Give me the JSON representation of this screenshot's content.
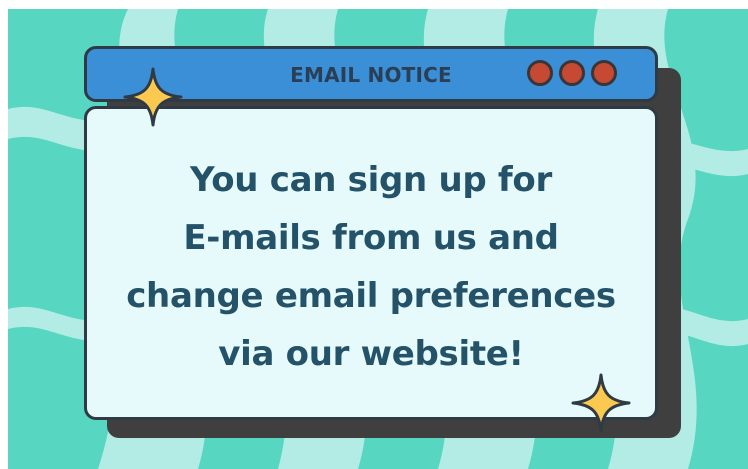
{
  "window": {
    "title": "EMAIL NOTICE",
    "message_lines": [
      "You can sign up for",
      "E-mails from us and",
      "change email preferences",
      "via our website!"
    ],
    "controls": [
      "window-control-1",
      "window-control-2",
      "window-control-3"
    ]
  },
  "colors": {
    "background_dark_stripe": "#57d6c2",
    "background_light_stripe": "#b3ece4",
    "titlebar": "#3a8fd6",
    "body": "#e6f9fb",
    "text": "#245268",
    "window_control": "#c64a33",
    "sparkle": "#fbc94f",
    "shadow": "#3f3f3f"
  },
  "icons": [
    "sparkle-icon",
    "sparkle-icon"
  ]
}
